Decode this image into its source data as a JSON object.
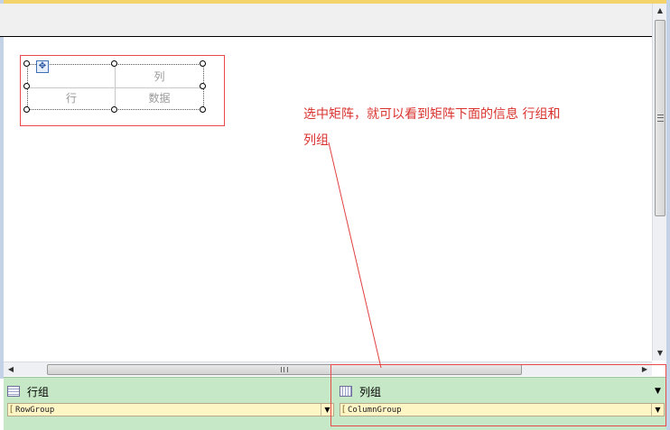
{
  "matrix": {
    "col_header": "列",
    "row_header": "行",
    "data_cell": "数据"
  },
  "annotation": {
    "line1": "选中矩阵，就可以看到矩阵下面的信息 行组和",
    "line2": "列组",
    "color": "#d9332e"
  },
  "grouping": {
    "row_groups_label": "行组",
    "row_group_name": "RowGroup",
    "column_groups_label": "列组",
    "column_group_name": "ColumnGroup",
    "pane_color": "#c6e8c6",
    "chip_color": "#fff6c5"
  },
  "icons": {
    "move_handle": "move-icon",
    "row_groups": "row-groups-icon",
    "column_groups": "column-groups-icon"
  }
}
